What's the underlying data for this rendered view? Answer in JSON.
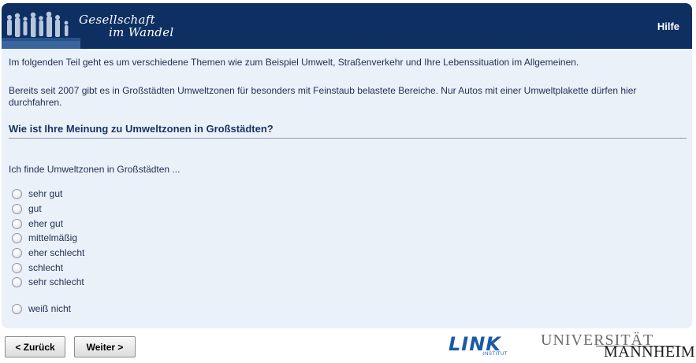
{
  "header": {
    "logo_line1": "Gesellschaft",
    "logo_line2": "im Wandel",
    "help_label": "Hilfe"
  },
  "intro": {
    "paragraph1": "Im folgenden Teil geht es um verschiedene Themen wie zum Beispiel Umwelt, Straßenverkehr und Ihre Lebenssituation im Allgemeinen.",
    "paragraph2": "Bereits seit 2007 gibt es in Großstädten Umweltzonen für besonders mit Feinstaub belastete Bereiche. Nur Autos mit einer Umweltplakette dürfen hier durchfahren."
  },
  "question": {
    "title": "Wie ist Ihre Meinung zu Umweltzonen in Großstädten?",
    "stem": "Ich finde Umweltzonen in Großstädten ...",
    "options": [
      "sehr gut",
      "gut",
      "eher gut",
      "mittelmäßig",
      "eher schlecht",
      "schlecht",
      "sehr schlecht",
      "weiß nicht"
    ]
  },
  "nav": {
    "back_label": "< Zurück",
    "next_label": "Weiter >"
  },
  "logos": {
    "link": "LINK",
    "link_sub": "INSTITUT",
    "uni_line1": "UNIVERSITÄT",
    "uni_line2": "MANNHEIM"
  },
  "colors": {
    "header_bg": "#0e2f62",
    "panel_bg": "#ebf1f9",
    "text": "#1f2f4f"
  }
}
